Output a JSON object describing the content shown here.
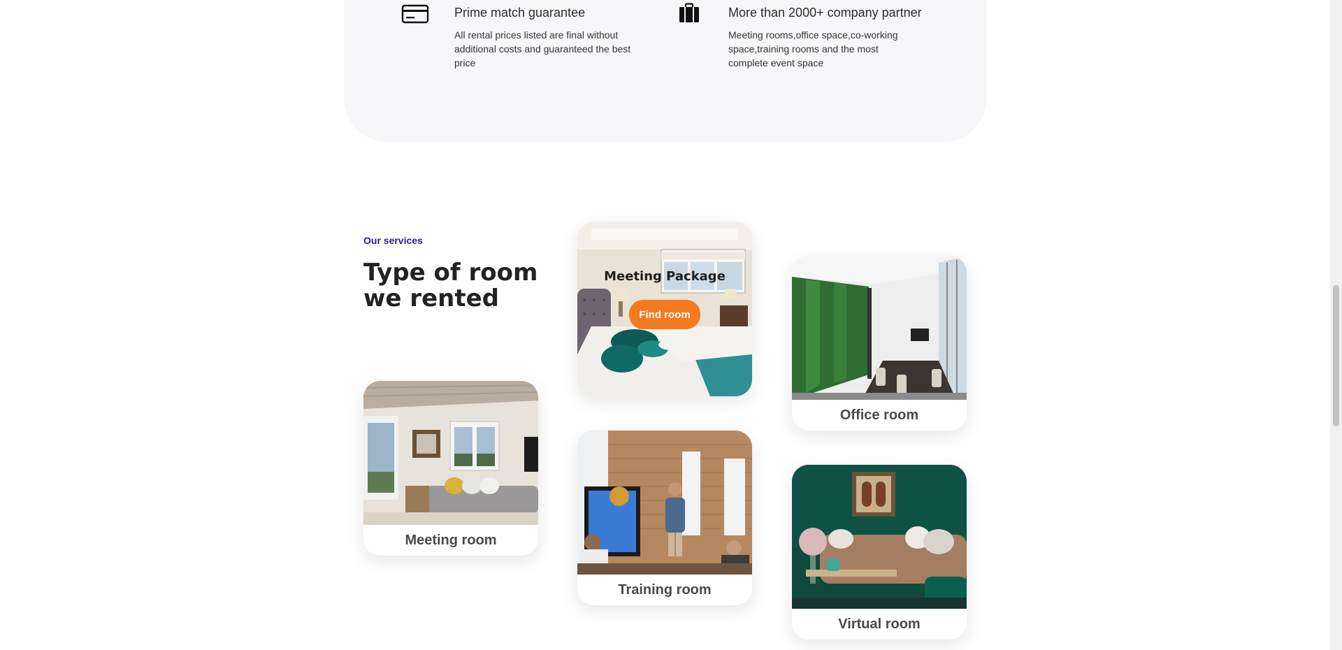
{
  "features": [
    {
      "icon": "credit-card-icon",
      "title": "Prime match guarantee",
      "description": "All rental prices listed are final without additional costs and guaranteed the best price"
    },
    {
      "icon": "briefcase-icon",
      "title": "More than 2000+ company partner",
      "description": "Meeting rooms,office space,co-working space,training rooms and the most complete event space"
    }
  ],
  "services": {
    "eyebrow": "Our services",
    "title": "Type of room we rented",
    "eyebrow_color": "#2d1a8c",
    "featured": {
      "title": "Meeting Package",
      "button_label": "Find room",
      "button_color": "#f47a20"
    },
    "rooms": [
      {
        "label": "Meeting room"
      },
      {
        "label": "Training room"
      },
      {
        "label": "Office room"
      },
      {
        "label": "Virtual room"
      }
    ]
  }
}
